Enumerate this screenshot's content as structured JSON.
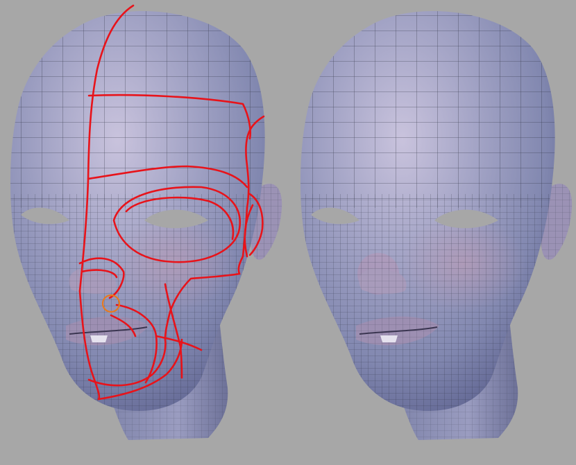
{
  "scene": {
    "background_color": "#a7a7a7",
    "skin_color": "#8e93b8",
    "skin_highlight": "#c7c2dc",
    "wire_color": "#2b2d3d",
    "flow_line_color": "#e8131a",
    "marker_color": "#e87a1e"
  },
  "heads": [
    {
      "id": "annotated",
      "shows_edge_flow_lines": true,
      "shows_marker_circle": true
    },
    {
      "id": "plain",
      "shows_edge_flow_lines": false,
      "shows_marker_circle": false
    }
  ]
}
